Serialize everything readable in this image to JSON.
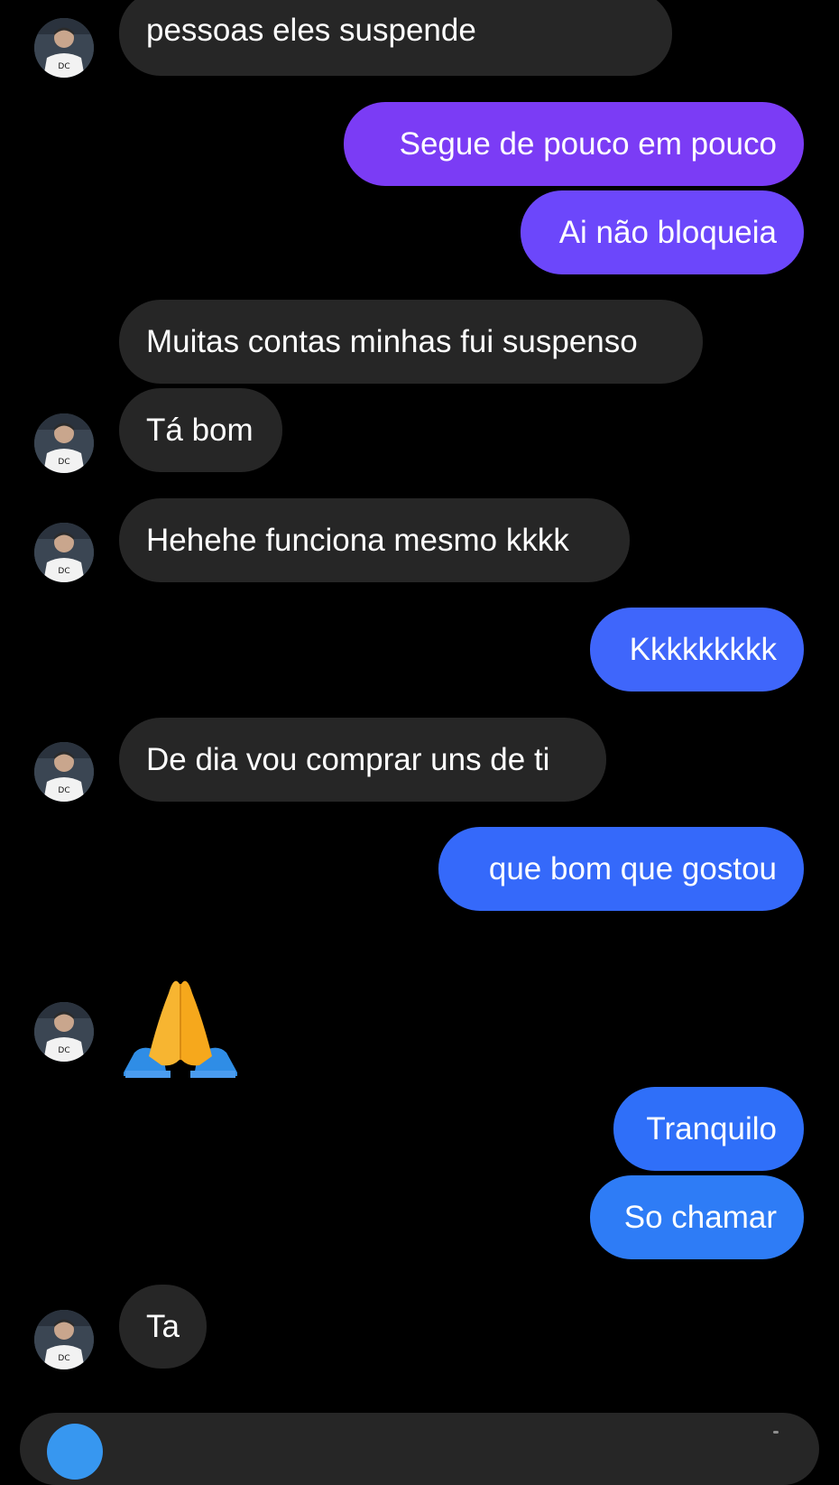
{
  "colors": {
    "background": "#000000",
    "received_bubble": "#262626",
    "sent_gradient": [
      "#7b3cf5",
      "#6c47fb",
      "#3f66fb",
      "#2f6ff9",
      "#2e7cf6"
    ],
    "composer_button": "#3797f0"
  },
  "messages": [
    {
      "direction": "received",
      "text": "pessoas eles suspende",
      "avatar": true
    },
    {
      "direction": "sent",
      "text": "Segue de pouco em pouco"
    },
    {
      "direction": "sent",
      "text": "Ai não bloqueia"
    },
    {
      "direction": "received",
      "text": "Muitas contas minhas fui suspenso",
      "avatar": false
    },
    {
      "direction": "received",
      "text": "Tá bom",
      "avatar": true
    },
    {
      "direction": "received",
      "text": "Hehehe funciona mesmo kkkk",
      "avatar": true
    },
    {
      "direction": "sent",
      "text": "Kkkkkkkkk"
    },
    {
      "direction": "received",
      "text": "De dia vou comprar uns de ti",
      "avatar": true
    },
    {
      "direction": "sent",
      "text": "que bom que gostou"
    },
    {
      "direction": "received",
      "emoji": "folded-hands",
      "avatar": true
    },
    {
      "direction": "sent",
      "text": "Tranquilo"
    },
    {
      "direction": "sent",
      "text": "So chamar"
    },
    {
      "direction": "received",
      "text": "Ta",
      "avatar": true
    }
  ],
  "avatar": {
    "icon": "user-avatar",
    "shirt_logo": "DC"
  },
  "composer": {
    "button_icon": "camera-icon"
  }
}
